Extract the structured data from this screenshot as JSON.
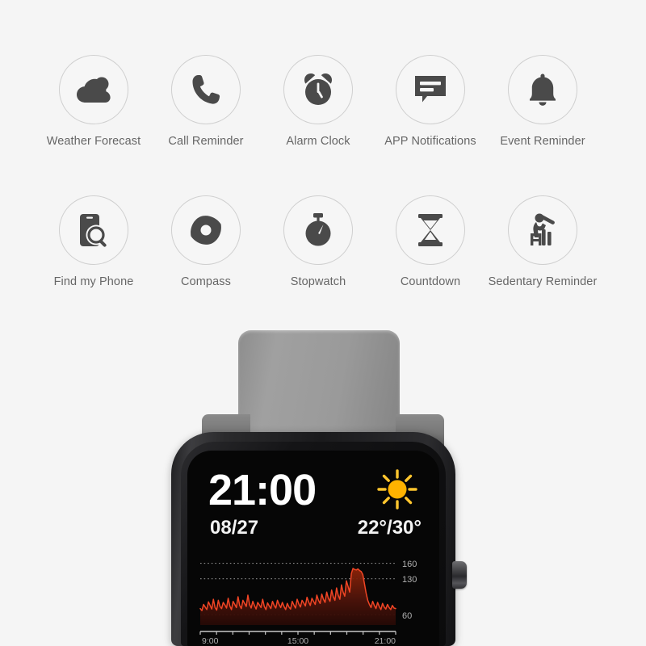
{
  "page": {
    "background_color": "#f5f5f5"
  },
  "features": {
    "rows": [
      [
        {
          "label": "Weather Forecast",
          "icon": "cloud-sun-icon"
        },
        {
          "label": "Call Reminder",
          "icon": "phone-icon"
        },
        {
          "label": "Alarm Clock",
          "icon": "alarm-clock-icon"
        },
        {
          "label": "APP Notifications",
          "icon": "chat-bubble-icon"
        },
        {
          "label": "Event Reminder",
          "icon": "bell-icon"
        }
      ],
      [
        {
          "label": "Find my Phone",
          "icon": "phone-search-icon"
        },
        {
          "label": "Compass",
          "icon": "compass-icon"
        },
        {
          "label": "Stopwatch",
          "icon": "stopwatch-icon"
        },
        {
          "label": "Countdown",
          "icon": "hourglass-icon"
        },
        {
          "label": "Sedentary Reminder",
          "icon": "person-stretching-icon"
        }
      ]
    ],
    "circle_border_color": "#cfcfcf",
    "icon_color": "#4a4a4a",
    "label_color": "#666666"
  },
  "watch": {
    "strap_color": "#9a9a9a",
    "case_color": "#1d1d1f",
    "screen_background": "#060606",
    "crown": {
      "name": "crown-button"
    },
    "face": {
      "time": "21:00",
      "date": "08/27",
      "temperature": "22°/30°",
      "weather_icon": "sun-icon",
      "weather_icon_color": "#ffb300",
      "time_color": "#ffffff"
    }
  },
  "chart_data": {
    "type": "line",
    "title": "",
    "xlabel": "",
    "ylabel": "",
    "line_color": "#f04525",
    "fill_color": "#5a1306",
    "grid": true,
    "grid_style": "dotted",
    "ylim": [
      40,
      175
    ],
    "yticks": [
      60,
      130,
      160
    ],
    "ytick_labels": [
      "60",
      "130",
      "160"
    ],
    "xticks": [
      "9:00",
      "15:00",
      "21:00"
    ],
    "xtick_labels": [
      "9:00",
      "15:00",
      "21:00"
    ],
    "x": [
      0,
      1,
      2,
      3,
      4,
      5,
      6,
      7,
      8,
      9,
      10,
      11,
      12,
      13,
      14,
      15,
      16,
      17,
      18,
      19,
      20,
      21,
      22,
      23,
      24,
      25,
      26,
      27,
      28,
      29,
      30,
      31,
      32,
      33,
      34,
      35,
      36,
      37,
      38,
      39,
      40,
      41,
      42,
      43,
      44,
      45,
      46,
      47,
      48,
      49,
      50,
      51,
      52,
      53,
      54,
      55,
      56,
      57,
      58,
      59,
      60,
      61,
      62,
      63,
      64,
      65,
      66,
      67,
      68,
      69,
      70,
      71,
      72,
      73,
      74,
      75,
      76,
      77,
      78,
      79,
      80,
      81,
      82,
      83,
      84,
      85,
      86,
      87,
      88,
      89,
      90,
      91,
      92,
      93,
      94,
      95,
      96,
      97,
      98,
      99,
      100,
      101,
      102,
      103,
      104,
      105,
      106,
      107,
      108,
      109,
      110,
      111,
      112,
      113,
      114,
      115,
      116,
      117,
      118,
      119
    ],
    "values": [
      72,
      68,
      80,
      75,
      70,
      85,
      78,
      71,
      90,
      74,
      69,
      88,
      76,
      72,
      84,
      79,
      73,
      92,
      77,
      70,
      86,
      80,
      74,
      95,
      78,
      72,
      88,
      82,
      76,
      98,
      80,
      73,
      86,
      78,
      71,
      84,
      79,
      74,
      90,
      76,
      70,
      83,
      77,
      72,
      86,
      78,
      73,
      88,
      80,
      74,
      84,
      76,
      70,
      82,
      75,
      71,
      86,
      79,
      73,
      90,
      81,
      75,
      88,
      83,
      77,
      94,
      85,
      78,
      92,
      86,
      80,
      98,
      88,
      82,
      100,
      90,
      84,
      104,
      92,
      86,
      108,
      95,
      88,
      112,
      98,
      90,
      118,
      104,
      96,
      126,
      115,
      104,
      140,
      150,
      148,
      147,
      149,
      146,
      144,
      138,
      120,
      102,
      88,
      80,
      74,
      86,
      78,
      72,
      84,
      76,
      70,
      82,
      75,
      71,
      80,
      74,
      70,
      78,
      73,
      72
    ]
  }
}
